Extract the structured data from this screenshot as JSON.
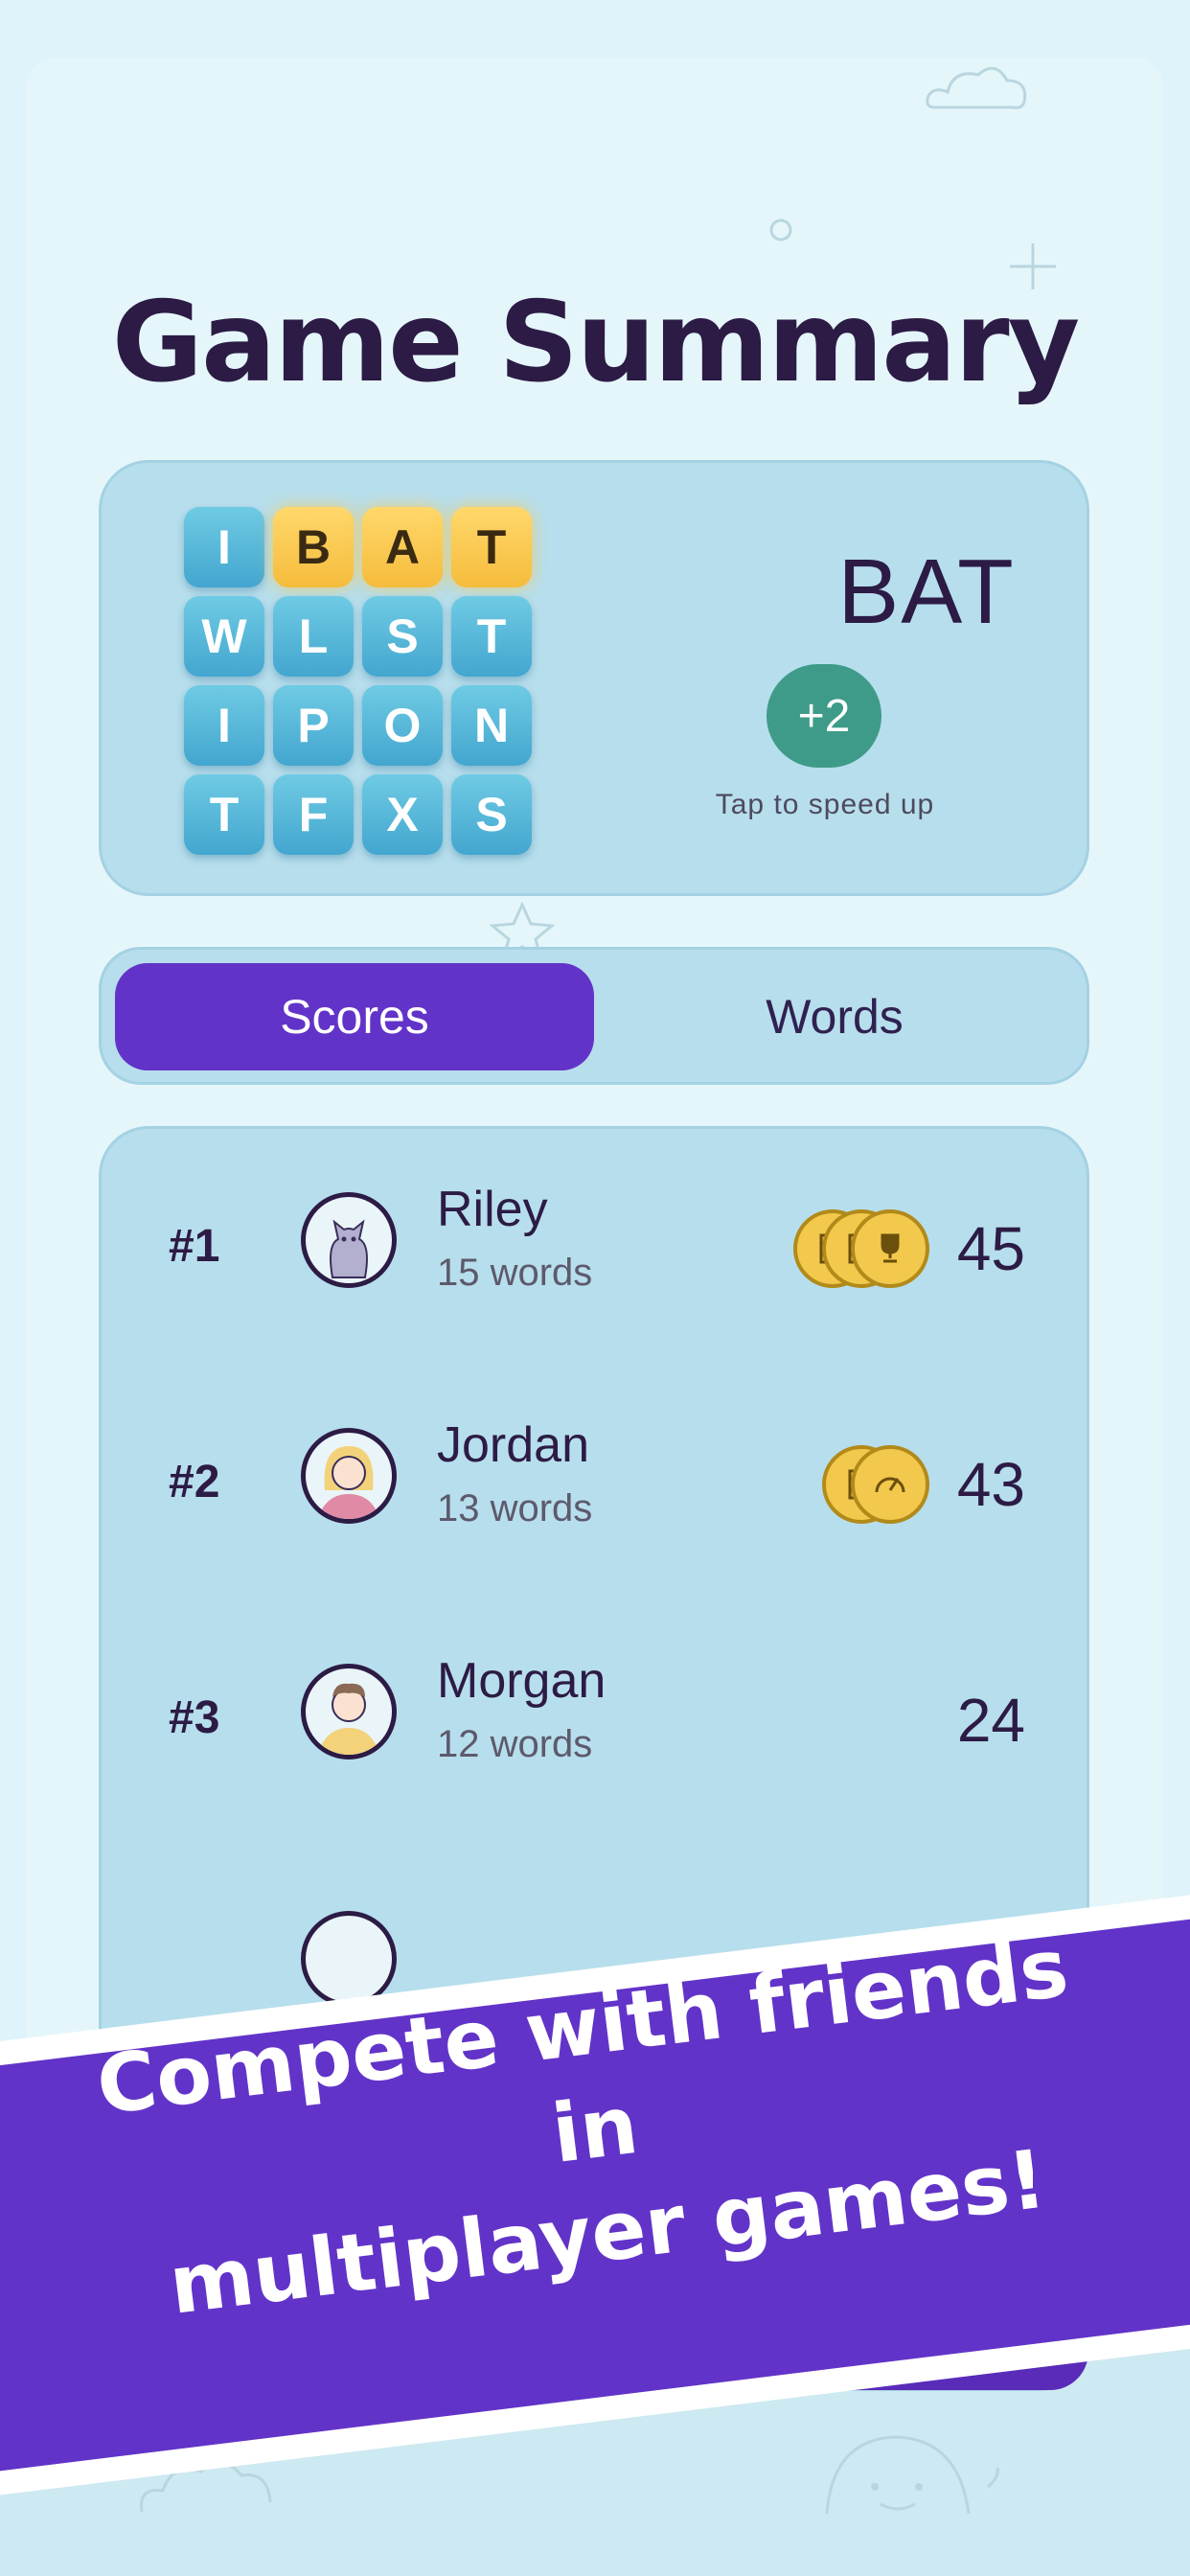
{
  "title": "Game Summary",
  "board": {
    "tiles": [
      "I",
      "B",
      "A",
      "T",
      "W",
      "L",
      "S",
      "T",
      "I",
      "P",
      "O",
      "N",
      "T",
      "F",
      "X",
      "S"
    ],
    "selected": [
      1,
      2,
      3
    ]
  },
  "current_word": {
    "word": "BAT",
    "bonus": "+2",
    "hint": "Tap to speed up"
  },
  "tabs": {
    "scores": "Scores",
    "words": "Words"
  },
  "players": [
    {
      "rank": "#1",
      "name": "Riley",
      "words": "15 words",
      "score": "45",
      "avatar": "cat-avatar-icon",
      "badges": [
        "book-badge-icon",
        "book-badge-icon",
        "trophy-badge-icon"
      ]
    },
    {
      "rank": "#2",
      "name": "Jordan",
      "words": "13 words",
      "score": "43",
      "avatar": "woman-avatar-icon",
      "badges": [
        "book-badge-icon",
        "speedometer-badge-icon"
      ]
    },
    {
      "rank": "#3",
      "name": "Morgan",
      "words": "12 words",
      "score": "24",
      "avatar": "man-avatar-icon",
      "badges": []
    }
  ],
  "banner": {
    "line1": "Compete with friends in",
    "line2": "multiplayer games!"
  },
  "colors": {
    "accent": "#6233c8",
    "tile": "#4fb3d9",
    "tile_selected": "#f7c948",
    "badge_green": "#3f9b89",
    "coin": "#f2c94c",
    "text_dark": "#2c1b45"
  }
}
